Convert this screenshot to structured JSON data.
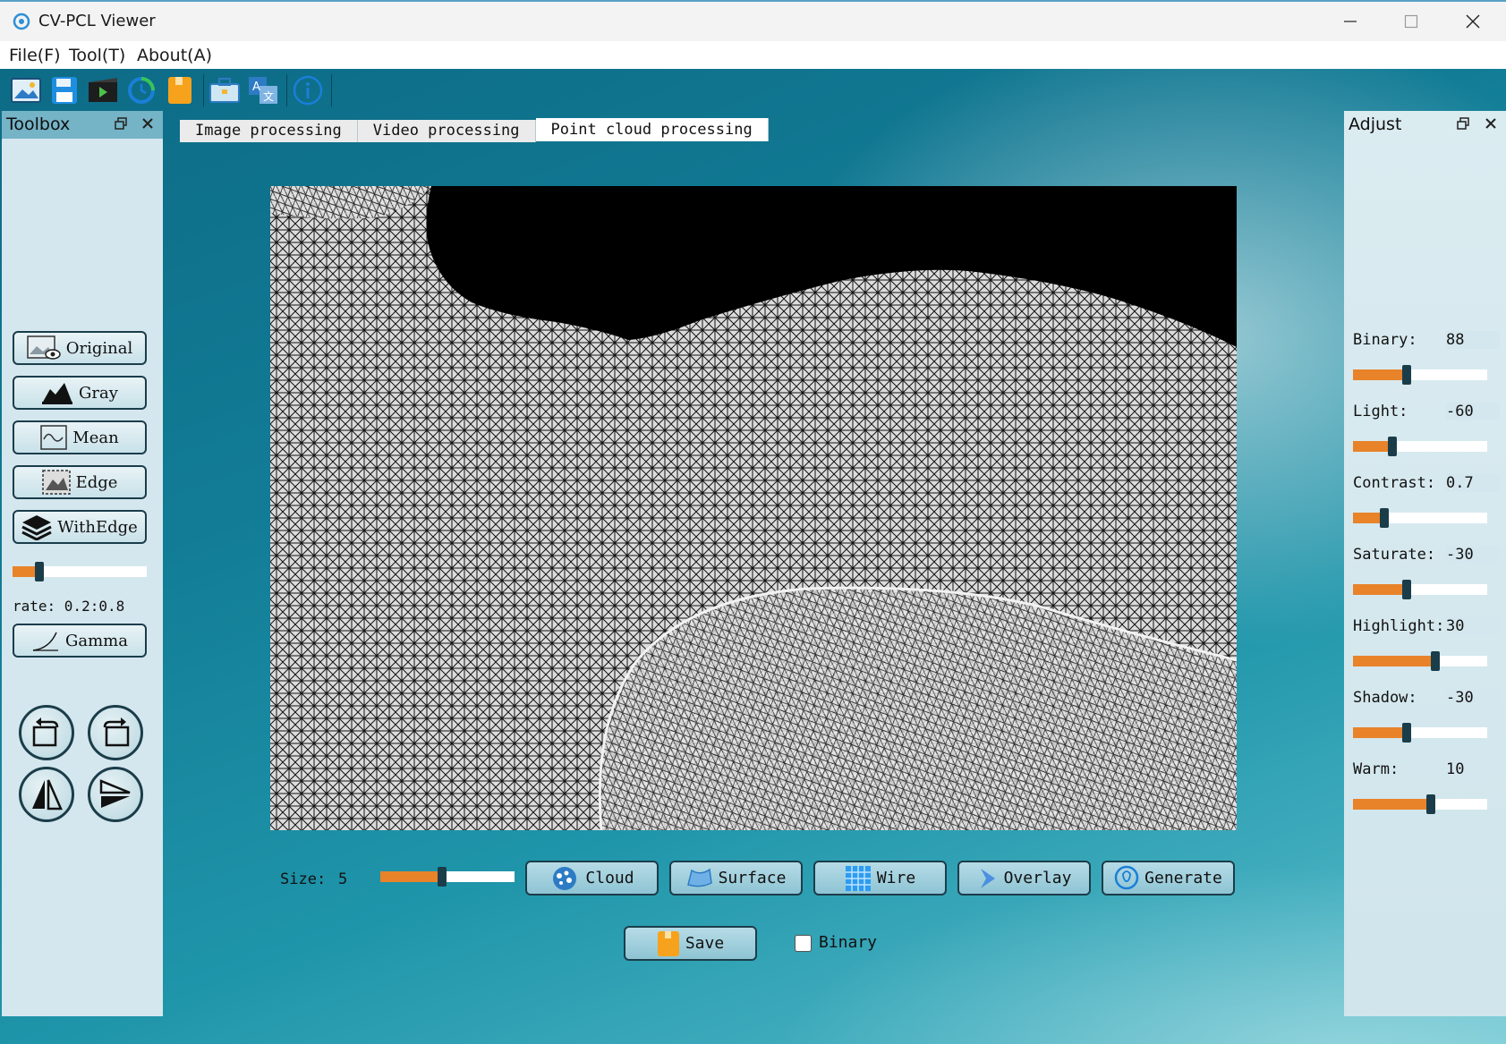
{
  "window": {
    "title": "CV-PCL Viewer"
  },
  "menu": [
    "File(F)",
    "Tool(T)",
    "About(A)"
  ],
  "toolbar": {
    "icons": [
      "open-image-icon",
      "save-icon",
      "video-icon",
      "refresh-icon",
      "bookmark-icon",
      "toolbox-icon",
      "translate-icon",
      "info-icon"
    ]
  },
  "toolbox": {
    "title": "Toolbox",
    "buttons": [
      "Original",
      "Gray",
      "Mean",
      "Edge",
      "WithEdge",
      "Gamma"
    ],
    "rate_slider": {
      "value": 0.2
    },
    "rate_label": "rate: 0.2:0.8"
  },
  "tabs": [
    "Image processing",
    "Video processing",
    "Point cloud processing"
  ],
  "active_tab": "Point cloud processing",
  "pointcloud": {
    "size_label": "Size:",
    "size_value": "5",
    "size_slider": {
      "value": 0.46
    },
    "buttons": [
      "Cloud",
      "Surface",
      "Wire",
      "Overlay",
      "Generate"
    ],
    "save_label": "Save",
    "binary_label": "Binary",
    "binary_checked": false
  },
  "adjust": {
    "title": "Adjust",
    "items": [
      {
        "label": "Binary:",
        "value": "88",
        "slider": 0.4
      },
      {
        "label": "Light:",
        "value": "-60",
        "slider": 0.29
      },
      {
        "label": "Contrast:",
        "value": "0.7",
        "slider": 0.23
      },
      {
        "label": "Saturate:",
        "value": "-30",
        "slider": 0.4
      },
      {
        "label": "Highlight:",
        "value": "30",
        "slider": 0.61
      },
      {
        "label": "Shadow:",
        "value": "-30",
        "slider": 0.4
      },
      {
        "label": "Warm:",
        "value": "10",
        "slider": 0.58
      }
    ]
  },
  "colors": {
    "accent": "#e8832a",
    "panel": "#d5e7ee",
    "panel_header": "#75b3c6"
  }
}
